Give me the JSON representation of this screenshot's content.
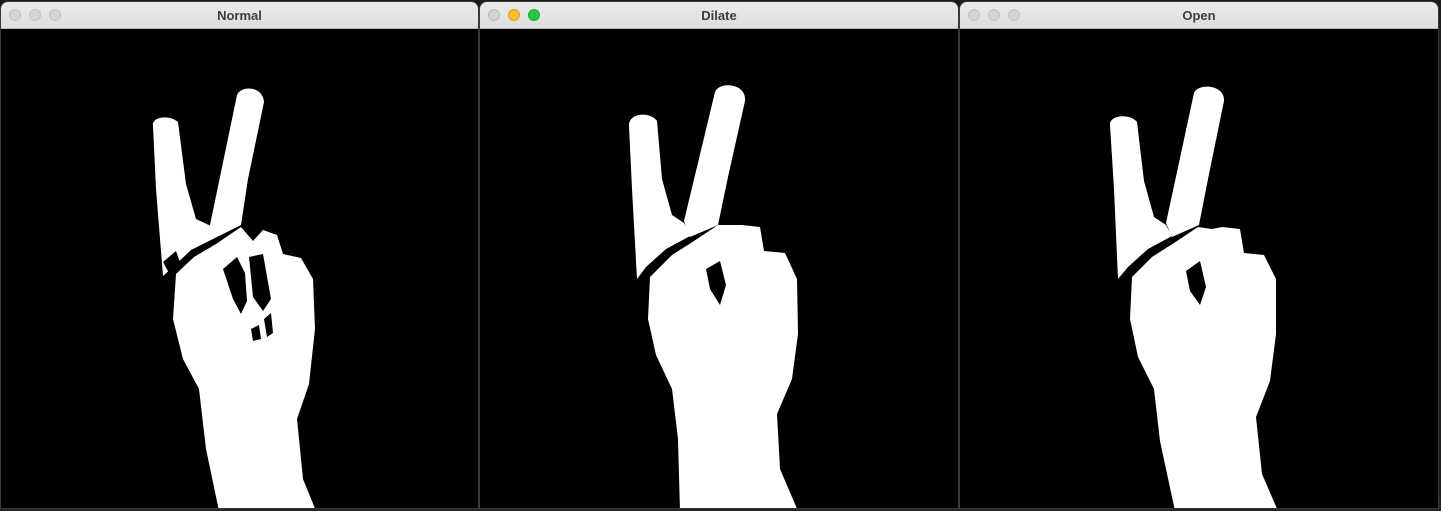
{
  "windows": [
    {
      "title": "Normal",
      "focused": false,
      "buttons": [
        "close-button",
        "minimize-button",
        "zoom-button"
      ]
    },
    {
      "title": "Dilate",
      "focused": true,
      "buttons": [
        "close-button",
        "minimize-button",
        "zoom-button"
      ]
    },
    {
      "title": "Open",
      "focused": false,
      "buttons": [
        "close-button",
        "minimize-button",
        "zoom-button"
      ]
    }
  ],
  "colors": {
    "mask_foreground": "#ffffff",
    "mask_background": "#000000",
    "minimize_active": "#febc2e",
    "zoom_active": "#28c840"
  },
  "content": {
    "image": "binary-hand-mask-peace-sign"
  }
}
